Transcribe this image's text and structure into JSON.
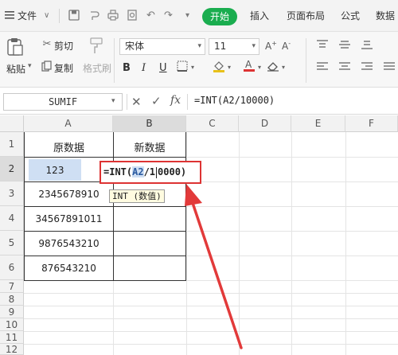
{
  "menubar": {
    "file_label": "文件",
    "tabs": [
      {
        "label": "开始"
      },
      {
        "label": "插入"
      },
      {
        "label": "页面布局"
      },
      {
        "label": "公式"
      },
      {
        "label": "数据"
      }
    ],
    "quick_icons": [
      "save-icon",
      "undo-history-icon",
      "print-icon",
      "preview-icon",
      "undo-icon",
      "redo-icon",
      "dropdown-icon"
    ]
  },
  "ribbon": {
    "paste_label": "粘贴",
    "cut_label": "剪切",
    "copy_label": "复制",
    "format_painter_label": "格式刷",
    "font_name": "宋体",
    "font_size": "11",
    "bold": "B",
    "italic": "I",
    "underline": "U"
  },
  "formula_bar": {
    "name_box": "SUMIF",
    "fx_label": "fx",
    "formula": "=INT(A2/10000)"
  },
  "grid": {
    "columns": [
      "A",
      "B",
      "C",
      "D",
      "E",
      "F"
    ],
    "rows": [
      "1",
      "2",
      "3",
      "4",
      "5",
      "6",
      "7",
      "8",
      "9",
      "10",
      "11",
      "12"
    ],
    "cells": {
      "a1": "原数据",
      "b1": "新数据",
      "a2": "123",
      "a3": "2345678910",
      "a4": "34567891011",
      "a5": "9876543210",
      "a6": "876543210"
    },
    "edit": {
      "prefix": "=INT(",
      "ref": "A2",
      "mid": "/1",
      "rest": "0000)"
    },
    "tooltip": "INT (数值)"
  },
  "colors": {
    "accent": "#1aad4f",
    "highlight": "#d33333",
    "selection": "#cfdff3"
  }
}
